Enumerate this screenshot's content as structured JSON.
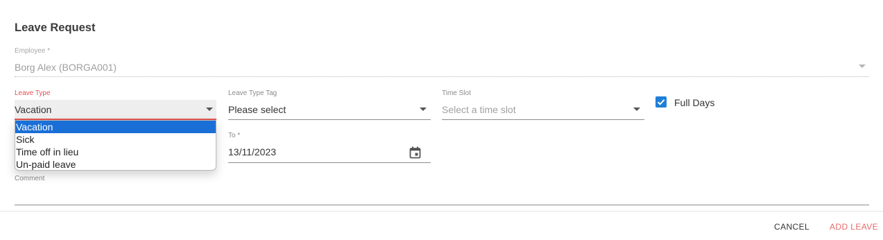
{
  "form": {
    "title": "Leave Request",
    "employee": {
      "label": "Employee *",
      "value": "Borg Alex (BORGA001)"
    },
    "leave_type": {
      "label": "Leave Type",
      "value": "Vacation",
      "options": [
        "Vacation",
        "Sick",
        "Time off in lieu",
        "Un-paid leave"
      ],
      "highlighted_option": "Vacation"
    },
    "leave_type_tag": {
      "label": "Leave Type Tag",
      "value": "Please select"
    },
    "time_slot": {
      "label": "Time Slot",
      "placeholder": "Select a time slot"
    },
    "full_days": {
      "label": "Full Days",
      "checked": true
    },
    "to": {
      "label": "To *",
      "value": "13/11/2023"
    },
    "comment": {
      "label": "Comment",
      "value": ""
    }
  },
  "actions": {
    "cancel_label": "CANCEL",
    "add_label": "ADD LEAVE"
  },
  "colors": {
    "accent_error": "#e05252",
    "checkbox_blue": "#1e7fd8",
    "selected_option": "#1a6fd6"
  },
  "icons": {
    "calendar": "calendar-icon",
    "caret": "chevron-down-icon",
    "check": "check-icon"
  }
}
